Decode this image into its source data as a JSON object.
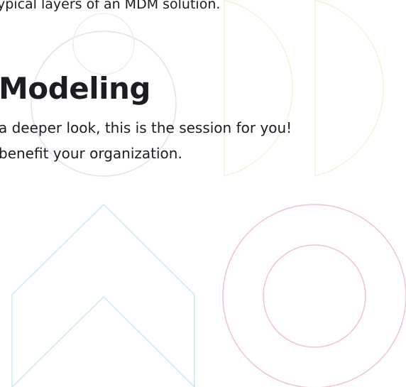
{
  "intro": {
    "text": "ypical layers of an MDM solution."
  },
  "session": {
    "title": "Modeling",
    "description_line_1": "a deeper look, this is the session for you!",
    "description_line_2": "benefit your organization."
  },
  "decor": {
    "purple": "#e4e0ee",
    "yellow": "#faf0d8",
    "cyan": "#c5ecf2",
    "pink": "#f2c2d2"
  }
}
